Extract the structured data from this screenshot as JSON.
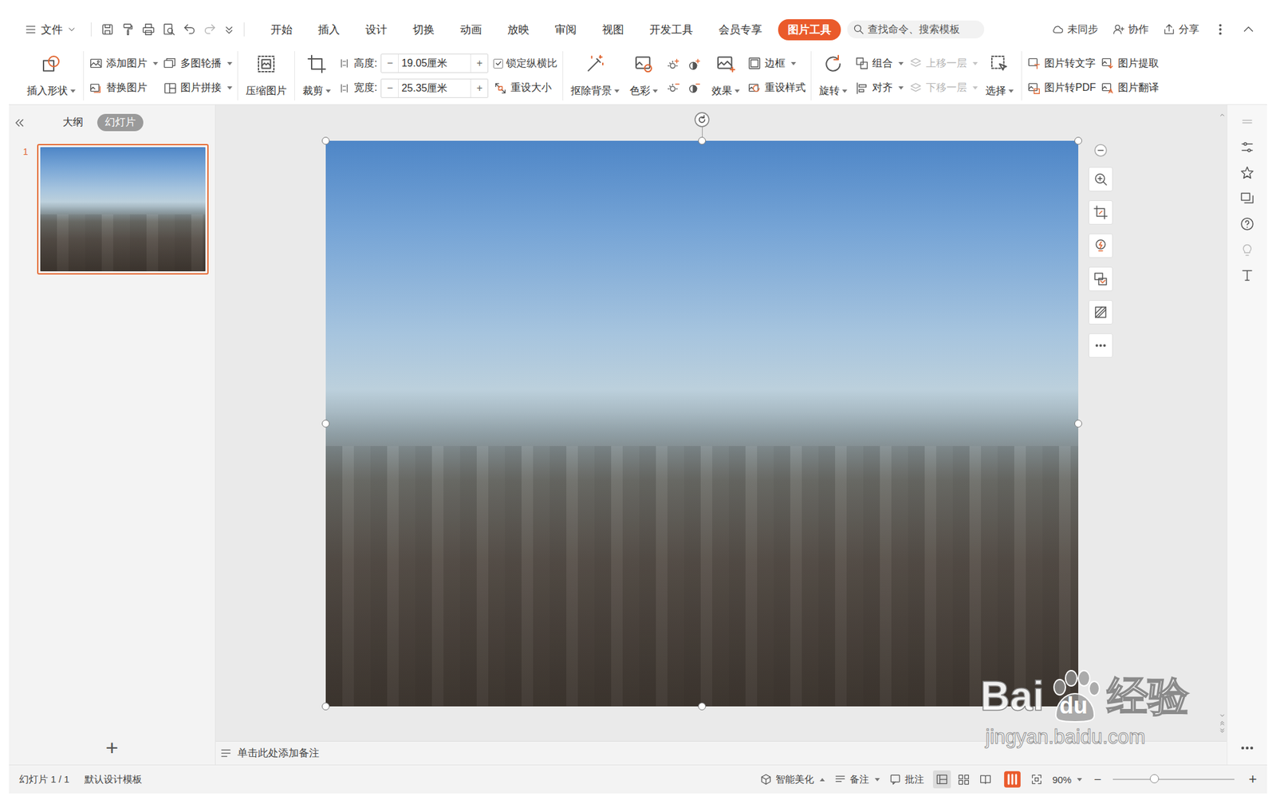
{
  "topbar": {
    "menu_label": "文件",
    "tabs": [
      {
        "label": "开始",
        "selected": false
      },
      {
        "label": "插入",
        "selected": false
      },
      {
        "label": "设计",
        "selected": false
      },
      {
        "label": "切换",
        "selected": false
      },
      {
        "label": "动画",
        "selected": false
      },
      {
        "label": "放映",
        "selected": false
      },
      {
        "label": "审阅",
        "selected": false
      },
      {
        "label": "视图",
        "selected": false
      },
      {
        "label": "开发工具",
        "selected": false
      },
      {
        "label": "会员专享",
        "selected": false
      },
      {
        "label": "图片工具",
        "selected": true
      }
    ],
    "search": {
      "placeholder": "查找命令、搜索模板"
    },
    "actions": [
      {
        "label": "未同步"
      },
      {
        "label": "协作"
      },
      {
        "label": "分享"
      }
    ]
  },
  "ribbon": {
    "groups": [
      [
        {
          "kind": "big",
          "label": "插入形状",
          "dropdown": true
        }
      ],
      [
        {
          "kind": "stack",
          "items": [
            {
              "kind": "small",
              "label": "添加图片",
              "dropdown": true,
              "disabled": false
            },
            {
              "kind": "small",
              "label": "替换图片",
              "dropdown": false,
              "disabled": false
            }
          ]
        },
        {
          "kind": "stack",
          "items": [
            {
              "kind": "small",
              "label": "多图轮播",
              "dropdown": true,
              "disabled": false
            },
            {
              "kind": "small",
              "label": "图片拼接",
              "dropdown": true,
              "disabled": false
            }
          ]
        }
      ],
      [
        {
          "kind": "big",
          "label": "压缩图片",
          "dropdown": false
        }
      ],
      [
        {
          "kind": "big",
          "label": "裁剪",
          "dropdown": true
        },
        {
          "kind": "stack",
          "items": [
            {
              "kind": "spin",
              "label": "高度:",
              "value": "19.05厘米",
              "minus": "−",
              "plus": "+"
            },
            {
              "kind": "spin",
              "label": "宽度:",
              "value": "25.35厘米",
              "minus": "−",
              "plus": "+"
            }
          ]
        },
        {
          "kind": "stack",
          "items": [
            {
              "kind": "check",
              "label": "锁定纵横比",
              "checked": true
            },
            {
              "kind": "small",
              "label": "重设大小",
              "dropdown": false,
              "disabled": false
            }
          ]
        }
      ],
      [
        {
          "kind": "big",
          "label": "抠除背景",
          "dropdown": true
        },
        {
          "kind": "big",
          "label": "色彩",
          "dropdown": true
        },
        {
          "kind": "icons"
        },
        {
          "kind": "big",
          "label": "效果",
          "dropdown": true
        },
        {
          "kind": "stack",
          "items": [
            {
              "kind": "small",
              "label": "边框",
              "dropdown": true,
              "disabled": false
            },
            {
              "kind": "small",
              "label": "重设样式",
              "dropdown": false,
              "disabled": false
            }
          ]
        }
      ],
      [
        {
          "kind": "big",
          "label": "旋转",
          "dropdown": true
        },
        {
          "kind": "stack",
          "items": [
            {
              "kind": "small",
              "label": "组合",
              "dropdown": true,
              "disabled": false
            },
            {
              "kind": "small",
              "label": "对齐",
              "dropdown": true,
              "disabled": false
            }
          ]
        },
        {
          "kind": "stack",
          "items": [
            {
              "kind": "small",
              "label": "上移一层",
              "dropdown": true,
              "disabled": true
            },
            {
              "kind": "small",
              "label": "下移一层",
              "dropdown": true,
              "disabled": true
            }
          ]
        },
        {
          "kind": "big",
          "label": "选择",
          "dropdown": true
        }
      ],
      [
        {
          "kind": "stack",
          "items": [
            {
              "kind": "small",
              "label": "图片转文字",
              "dropdown": false,
              "disabled": false
            },
            {
              "kind": "small",
              "label": "图片转PDF",
              "dropdown": false,
              "disabled": false
            }
          ]
        },
        {
          "kind": "stack",
          "items": [
            {
              "kind": "small",
              "label": "图片提取",
              "dropdown": false,
              "disabled": false
            },
            {
              "kind": "small",
              "label": "图片翻译",
              "dropdown": false,
              "disabled": false
            }
          ]
        }
      ]
    ]
  },
  "slide_pane": {
    "tabs": [
      {
        "label": "大纲",
        "selected": false
      },
      {
        "label": "幻灯片",
        "selected": true
      }
    ],
    "slides": [
      {
        "number": "1",
        "selected": true
      }
    ],
    "add": "+"
  },
  "notes": {
    "text": "单击此处添加备注"
  },
  "status_bar": {
    "slide_info": "幻灯片 1 / 1",
    "template": "默认设计模板",
    "smart": {
      "label": "智能美化",
      "dropdown": true
    },
    "notes": {
      "label": "备注",
      "dropdown": true
    },
    "comments": {
      "label": "批注"
    },
    "views": [
      {
        "selected": true
      },
      {
        "selected": false
      },
      {
        "selected": false
      }
    ],
    "zoom": {
      "value": "90%",
      "dropdown": true,
      "minus": "−",
      "plus": "+",
      "level": 0.34
    }
  },
  "watermark": {
    "brand": "Bai",
    "logo": "du",
    "product": "经验",
    "url": "jingyan.baidu.com"
  }
}
